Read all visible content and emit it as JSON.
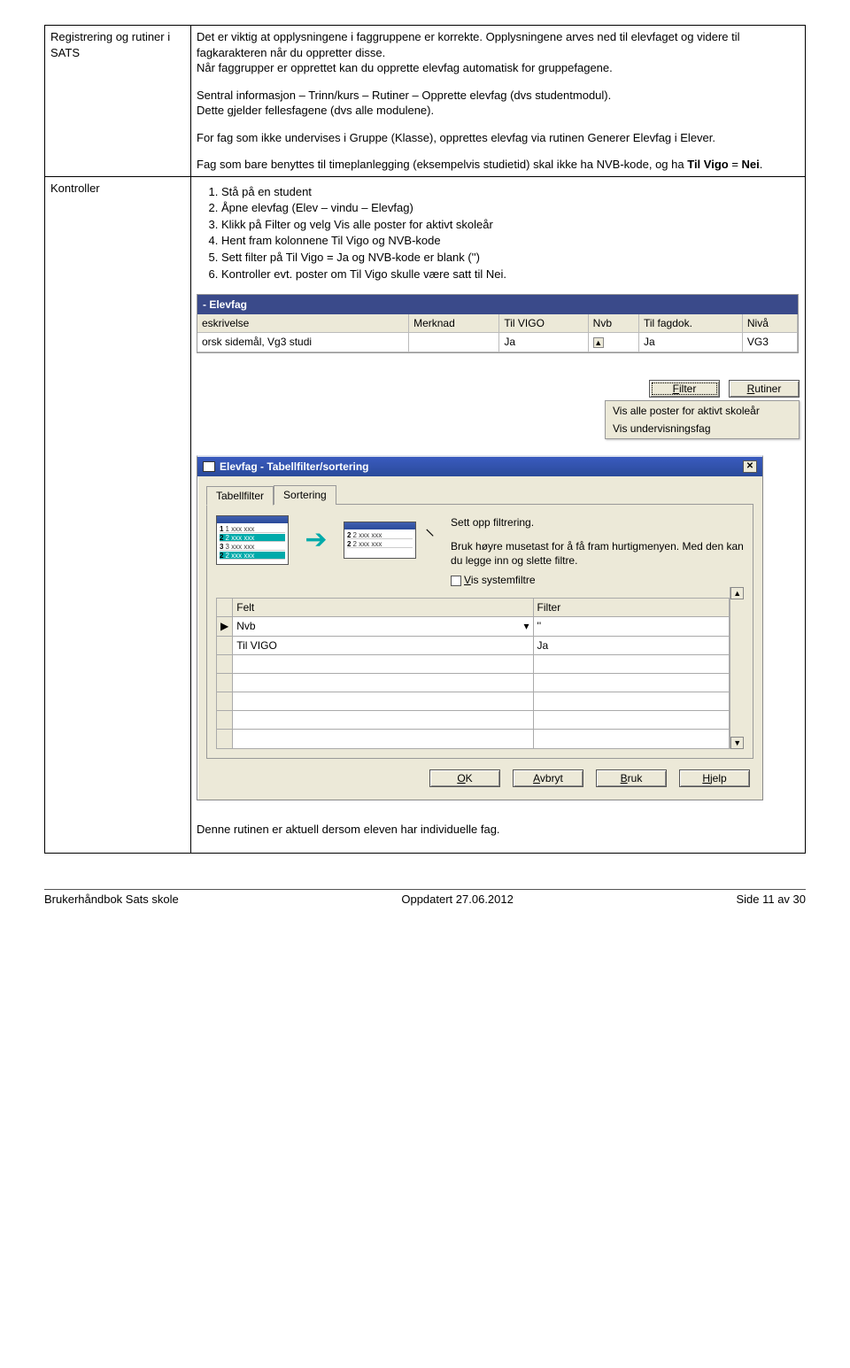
{
  "row1": {
    "label": "Registrering og rutiner i SATS",
    "p1": "Det er viktig at opplysningene i faggruppene er korrekte.  Opplysningene arves ned til elevfaget og videre til fagkarakteren når du oppretter disse.",
    "p2": "Når faggrupper er opprettet kan du opprette elevfag automatisk for gruppefagene.",
    "p3a": "Sentral informasjon – Trinn/kurs – Rutiner – Opprette elevfag (dvs studentmodul).",
    "p3b": "Dette gjelder fellesfagene (dvs alle modulene).",
    "p4": "For fag som ikke undervises i Gruppe (Klasse), opprettes elevfag via rutinen Generer Elevfag i Elever.",
    "p5a": "Fag som bare benyttes til timeplanlegging (eksempelvis studietid) skal ikke ha NVB-kode, og ha ",
    "p5b": "Til Vigo",
    "p5c": " = ",
    "p5d": "Nei",
    "p5e": "."
  },
  "row2": {
    "label": "Kontroller",
    "steps": [
      "Stå på en student",
      "Åpne elevfag (Elev – vindu – Elevfag)",
      "Klikk på Filter og velg Vis alle poster for aktivt skoleår",
      "Hent fram kolonnene Til Vigo og NVB-kode",
      "Sett filter på Til Vigo = Ja og NVB-kode er blank ('')",
      "Kontroller evt. poster om Til Vigo skulle være satt til Nei."
    ],
    "note": "Denne rutinen er aktuell dersom eleven har individuelle fag."
  },
  "elevfag": {
    "title": "- Elevfag",
    "headers": [
      "eskrivelse",
      "Merknad",
      "Til VIGO",
      "Nvb",
      "Til fagdok.",
      "Nivå"
    ],
    "row": [
      "orsk sidemål, Vg3 studi",
      "",
      "Ja",
      "",
      "Ja",
      "VG3"
    ]
  },
  "popup": {
    "btn_filter": "Filter",
    "btn_rutiner": "Rutiner",
    "menu": [
      "Vis alle poster for aktivt skoleår",
      "Vis undervisningsfag"
    ]
  },
  "dialog": {
    "title": "Elevfag - Tabellfilter/sortering",
    "tabs": [
      "Tabellfilter",
      "Sortering"
    ],
    "help_title": "Sett opp filtrering.",
    "help_p": "Bruk høyre musetast for å få fram hurtigmenyen. Med den kan du legge inn og slette filtre.",
    "chk_label": "Vis systemfiltre",
    "grid_headers": [
      "Felt",
      "Filter"
    ],
    "grid_rows": [
      {
        "felt": "Nvb",
        "filter": "''"
      },
      {
        "felt": "Til VIGO",
        "filter": "Ja"
      }
    ],
    "mini_rows_left": [
      "1 xxx xxx",
      "2 xxx xxx",
      "3 xxx xxx",
      "2 xxx xxx"
    ],
    "mini_rows_right": [
      "2 xxx xxx",
      "2 xxx xxx"
    ],
    "buttons": {
      "ok": "OK",
      "cancel": "Avbryt",
      "apply": "Bruk",
      "help": "Hjelp"
    }
  },
  "footer": {
    "left": "Brukerhåndbok Sats skole",
    "center": "Oppdatert  27.06.2012",
    "right": "Side 11  av 30"
  }
}
